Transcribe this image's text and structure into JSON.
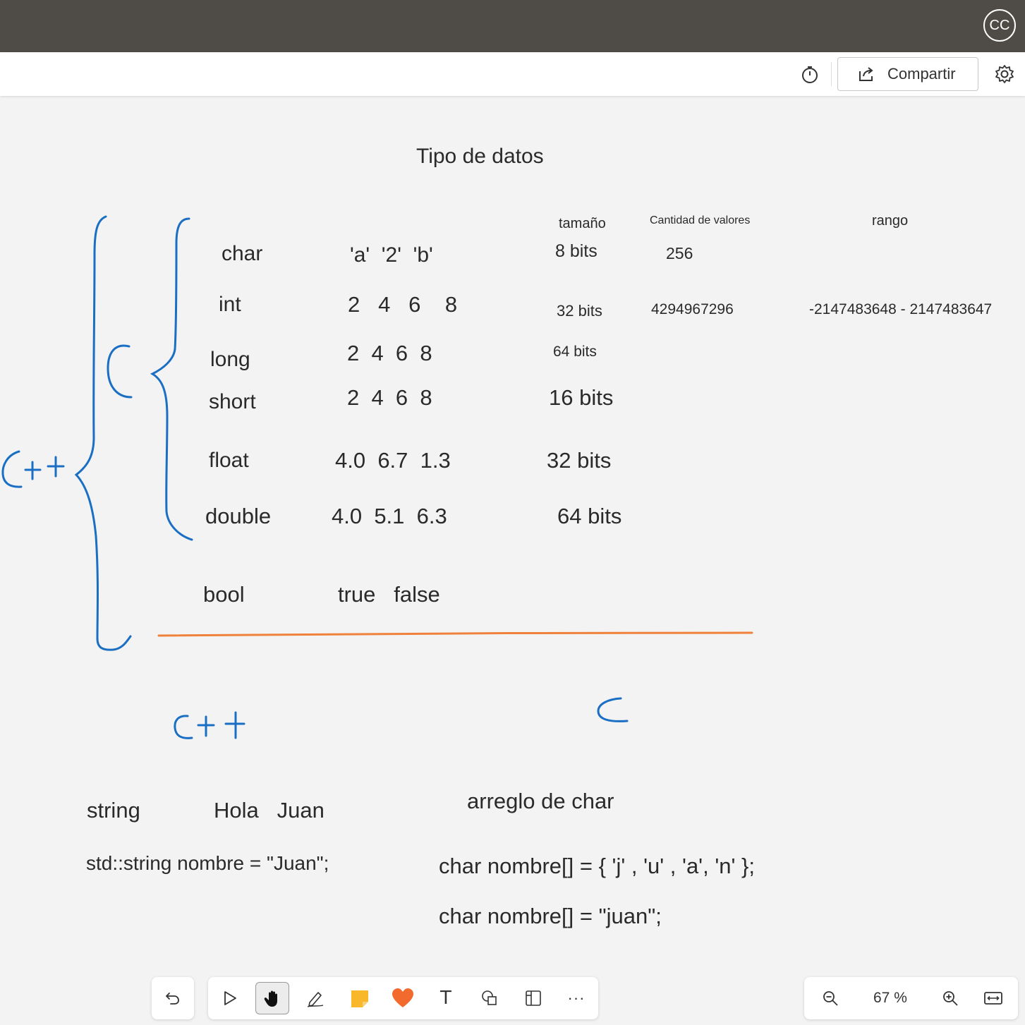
{
  "header": {
    "cc_label": "CC"
  },
  "toolbar": {
    "share_label": "Compartir",
    "icons": [
      "timer-icon",
      "share-icon",
      "gear-icon"
    ]
  },
  "board": {
    "title": "Tipo de datos",
    "columns": {
      "size": "tamaño",
      "count": "Cantidad de valores",
      "range": "rango"
    },
    "types": [
      {
        "name": "char",
        "examples": "'a'  '2'  'b'",
        "size": "8 bits",
        "count": "256",
        "range": ""
      },
      {
        "name": "int",
        "examples": "2   4   6    8",
        "size": "32 bits",
        "count": "4294967296",
        "range": "-2147483648 - 2147483647"
      },
      {
        "name": "long",
        "examples": "2  4  6  8",
        "size": "64 bits",
        "count": "",
        "range": ""
      },
      {
        "name": "short",
        "examples": "2  4  6  8",
        "size": "16 bits",
        "count": "",
        "range": ""
      },
      {
        "name": "float",
        "examples": "4.0  6.7  1.3",
        "size": "32 bits",
        "count": "",
        "range": ""
      },
      {
        "name": "double",
        "examples": "4.0  5.1  6.3",
        "size": "64 bits",
        "count": "",
        "range": ""
      },
      {
        "name": "bool",
        "examples": "true   false",
        "size": "",
        "count": "",
        "range": ""
      }
    ],
    "handwriting": {
      "cpp_left": "C++",
      "c_small": "C",
      "cpp_bottom": "C++",
      "c_bottom": "C"
    },
    "strings": {
      "string_label": "string",
      "string_example": "Hola   Juan",
      "std_decl": "std::string nombre = \"Juan\";",
      "char_array_label": "arreglo de char",
      "char_decl_1": "char nombre[] = { 'j' , 'u' , 'a', 'n' };",
      "char_decl_2": "char nombre[] = \"juan\";"
    }
  },
  "bottom_toolbar": {
    "tools": [
      "undo-icon",
      "select-icon",
      "hand-icon",
      "pen-icon",
      "sticky-note-icon",
      "reaction-heart-icon",
      "text-icon",
      "shapes-icon",
      "template-icon",
      "more-icon"
    ],
    "active_tool": "hand-icon",
    "more_label": "···",
    "text_tool_label": "T",
    "zoom": "67 %"
  },
  "colors": {
    "ink_blue": "#1a6fc4",
    "ink_orange": "#f0813a",
    "topbar": "#4f4c47"
  }
}
